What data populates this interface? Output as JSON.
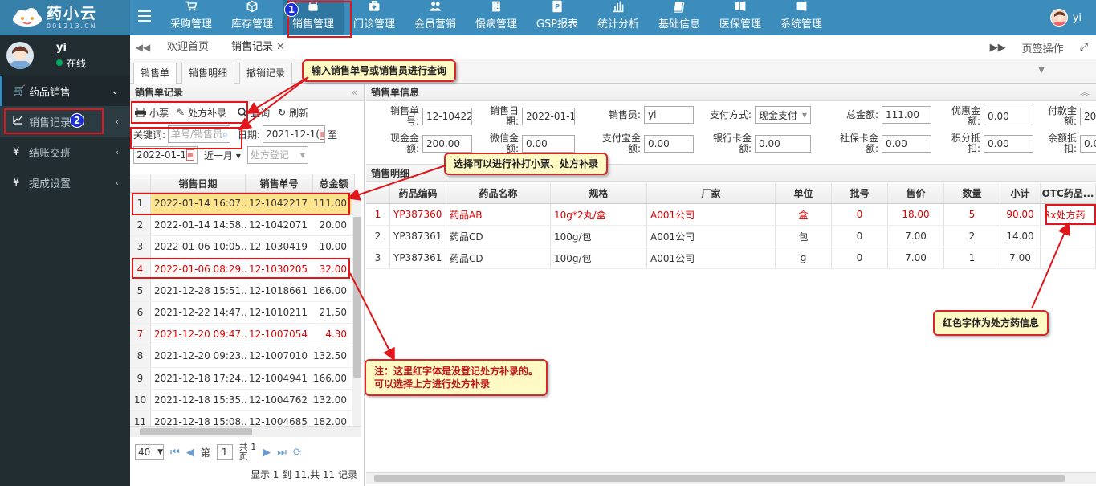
{
  "brand": {
    "name": "药小云",
    "sub": "001213.CN"
  },
  "topnav": [
    {
      "label": "采购管理",
      "icon": "cart-icon"
    },
    {
      "label": "库存管理",
      "icon": "box-icon"
    },
    {
      "label": "销售管理",
      "icon": "register-icon",
      "active": true
    },
    {
      "label": "门诊管理",
      "icon": "medkit-icon"
    },
    {
      "label": "会员营销",
      "icon": "users-icon"
    },
    {
      "label": "慢病管理",
      "icon": "building-icon"
    },
    {
      "label": "GSP报表",
      "icon": "report-icon"
    },
    {
      "label": "统计分析",
      "icon": "chart-icon"
    },
    {
      "label": "基础信息",
      "icon": "book-icon"
    },
    {
      "label": "医保管理",
      "icon": "windows-icon"
    },
    {
      "label": "系统管理",
      "icon": "windows-icon"
    }
  ],
  "user": {
    "name": "yi",
    "status": "在线"
  },
  "sidebar": {
    "items": [
      {
        "label": "药品销售",
        "chev": "⌄"
      },
      {
        "label": "销售记录",
        "chev": "‹"
      },
      {
        "label": "结账交班",
        "chev": "‹"
      },
      {
        "label": "提成设置",
        "chev": "‹"
      }
    ]
  },
  "pagetabs": {
    "home": "欢迎首页",
    "current": "销售记录",
    "close": "✕",
    "right_label": "页签操作"
  },
  "subtabs": [
    "销售单",
    "销售明细",
    "撤销记录"
  ],
  "left": {
    "title": "销售单记录",
    "btn_receipt": "小票",
    "btn_rx": "处方补录",
    "btn_query": "查询",
    "btn_refresh": "刷新",
    "keyword_label": "关键词:",
    "keyword_placeholder": "单号/销售员",
    "date_label": "日期:",
    "date_from": "2021-12-1(",
    "date_to_label": "至",
    "date_to": "2022-01-1",
    "range": "近一月",
    "rx_filter": "处方登记",
    "columns": [
      "销售日期",
      "销售单号",
      "总金额"
    ],
    "rows": [
      {
        "n": "1",
        "date": "2022-01-14 16:07...",
        "no": "12-1042217",
        "amt": "111.00",
        "state": "sel"
      },
      {
        "n": "2",
        "date": "2022-01-14 14:58...",
        "no": "12-1042071",
        "amt": "20.00",
        "state": ""
      },
      {
        "n": "3",
        "date": "2022-01-06 10:05...",
        "no": "12-1030419",
        "amt": "10.00",
        "state": ""
      },
      {
        "n": "4",
        "date": "2022-01-06 08:29...",
        "no": "12-1030205",
        "amt": "32.00",
        "state": "red"
      },
      {
        "n": "5",
        "date": "2021-12-28 15:51...",
        "no": "12-1018661",
        "amt": "166.00",
        "state": ""
      },
      {
        "n": "6",
        "date": "2021-12-22 14:47...",
        "no": "12-1010211",
        "amt": "21.50",
        "state": ""
      },
      {
        "n": "7",
        "date": "2021-12-20 09:47...",
        "no": "12-1007054",
        "amt": "4.30",
        "state": "red"
      },
      {
        "n": "8",
        "date": "2021-12-20 09:23...",
        "no": "12-1007010",
        "amt": "132.50",
        "state": ""
      },
      {
        "n": "9",
        "date": "2021-12-18 17:24...",
        "no": "12-1004941",
        "amt": "166.00",
        "state": ""
      },
      {
        "n": "10",
        "date": "2021-12-18 15:35...",
        "no": "12-1004762",
        "amt": "132.00",
        "state": ""
      },
      {
        "n": "11",
        "date": "2021-12-18 15:08...",
        "no": "12-1004685",
        "amt": "182.00",
        "state": ""
      }
    ],
    "pager": {
      "size": "40",
      "page_label": "第",
      "page": "1",
      "total_label_1": "共 1",
      "total_label_2": "页",
      "info": "显示 1 到 11,共 11 记录"
    }
  },
  "right": {
    "title": "销售单信息",
    "fields": [
      {
        "label1": "销售单",
        "label2": "号:",
        "value": "12-10422`"
      },
      {
        "label1": "销售日",
        "label2": "期:",
        "value": "2022-01-1"
      },
      {
        "label1": "销售员:",
        "label2": "",
        "value": "yi"
      },
      {
        "label1": "支付方式:",
        "label2": "",
        "value": "现金支付"
      },
      {
        "label1": "总金额:",
        "label2": "",
        "value": "111.00"
      },
      {
        "label1": "优惠金",
        "label2": "额:",
        "value": "0.00"
      },
      {
        "label1": "付款金",
        "label2": "额:",
        "value": "20"
      },
      {
        "label1": "现金金",
        "label2": "额:",
        "value": "200.00"
      },
      {
        "label1": "微信金",
        "label2": "额:",
        "value": "0.00"
      },
      {
        "label1": "支付宝金",
        "label2": "额:",
        "value": "0.00"
      },
      {
        "label1": "银行卡金",
        "label2": "额:",
        "value": "0.00"
      },
      {
        "label1": "社保卡金",
        "label2": "额:",
        "value": "0.00"
      },
      {
        "label1": "积分抵",
        "label2": "扣:",
        "value": "0.00"
      },
      {
        "label1": "余额抵",
        "label2": "扣:",
        "value": "0.00"
      }
    ],
    "detail_title": "销售明细",
    "columns": [
      "药品编码",
      "药品名称",
      "规格",
      "厂家",
      "单位",
      "批号",
      "售价",
      "数量",
      "小计",
      "OTC药品..."
    ],
    "rows": [
      {
        "n": "1",
        "code": "YP387360",
        "name": "药品AB",
        "spec": "10g*2丸/盒",
        "maker": "A001公司",
        "unit": "盒",
        "batch": "0",
        "price": "18.00",
        "qty": "5",
        "sub": "90.00",
        "otc": "Rx处方药",
        "red": true
      },
      {
        "n": "2",
        "code": "YP387361",
        "name": "药品CD",
        "spec": "100g/包",
        "maker": "A001公司",
        "unit": "包",
        "batch": "0",
        "price": "7.00",
        "qty": "2",
        "sub": "14.00",
        "otc": "",
        "red": false
      },
      {
        "n": "3",
        "code": "YP387361",
        "name": "药品CD",
        "spec": "100g/包",
        "maker": "A001公司",
        "unit": "g",
        "batch": "0",
        "price": "7.00",
        "qty": "1",
        "sub": "7.00",
        "otc": "",
        "red": false
      }
    ]
  },
  "annotations": {
    "badge1": "1",
    "badge2": "2",
    "callout_query": "输入销售单号或销售员进行查询",
    "callout_rx": "选择可以进行补打小票、处方补录",
    "callout_red": "红色字体为处方药信息",
    "callout_note_1": "注：这里红字体是没登记处方补录的。",
    "callout_note_2": "可以选择上方进行处方补录"
  },
  "colors": {
    "header": "#3c8dbc",
    "sidebar": "#222d32",
    "selected_row": "#ffe48d",
    "rx_red": "#dd0000",
    "callout_border": "#d8262b",
    "badge": "#1b2fd8"
  }
}
